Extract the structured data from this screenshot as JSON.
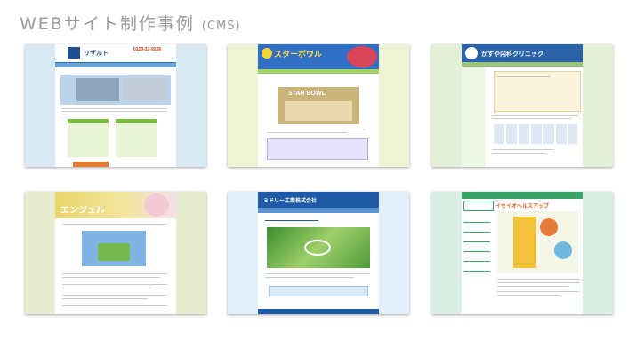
{
  "heading": {
    "main": "WEBサイト制作事例",
    "sub": "(CMS)"
  },
  "thumbnails": [
    {
      "id": "result",
      "logo": "リザルト",
      "phone": "0120-22-9226"
    },
    {
      "id": "bowl",
      "logo": "スターボウル",
      "banner": "STAR BOWL"
    },
    {
      "id": "clinic",
      "logo": "かすや内科クリニック"
    },
    {
      "id": "angel",
      "logo": "エンジェル"
    },
    {
      "id": "kougyo",
      "logo": "ミドリー工業株式会社"
    },
    {
      "id": "kenko",
      "logo": "イセイオヘルスアップ"
    }
  ]
}
